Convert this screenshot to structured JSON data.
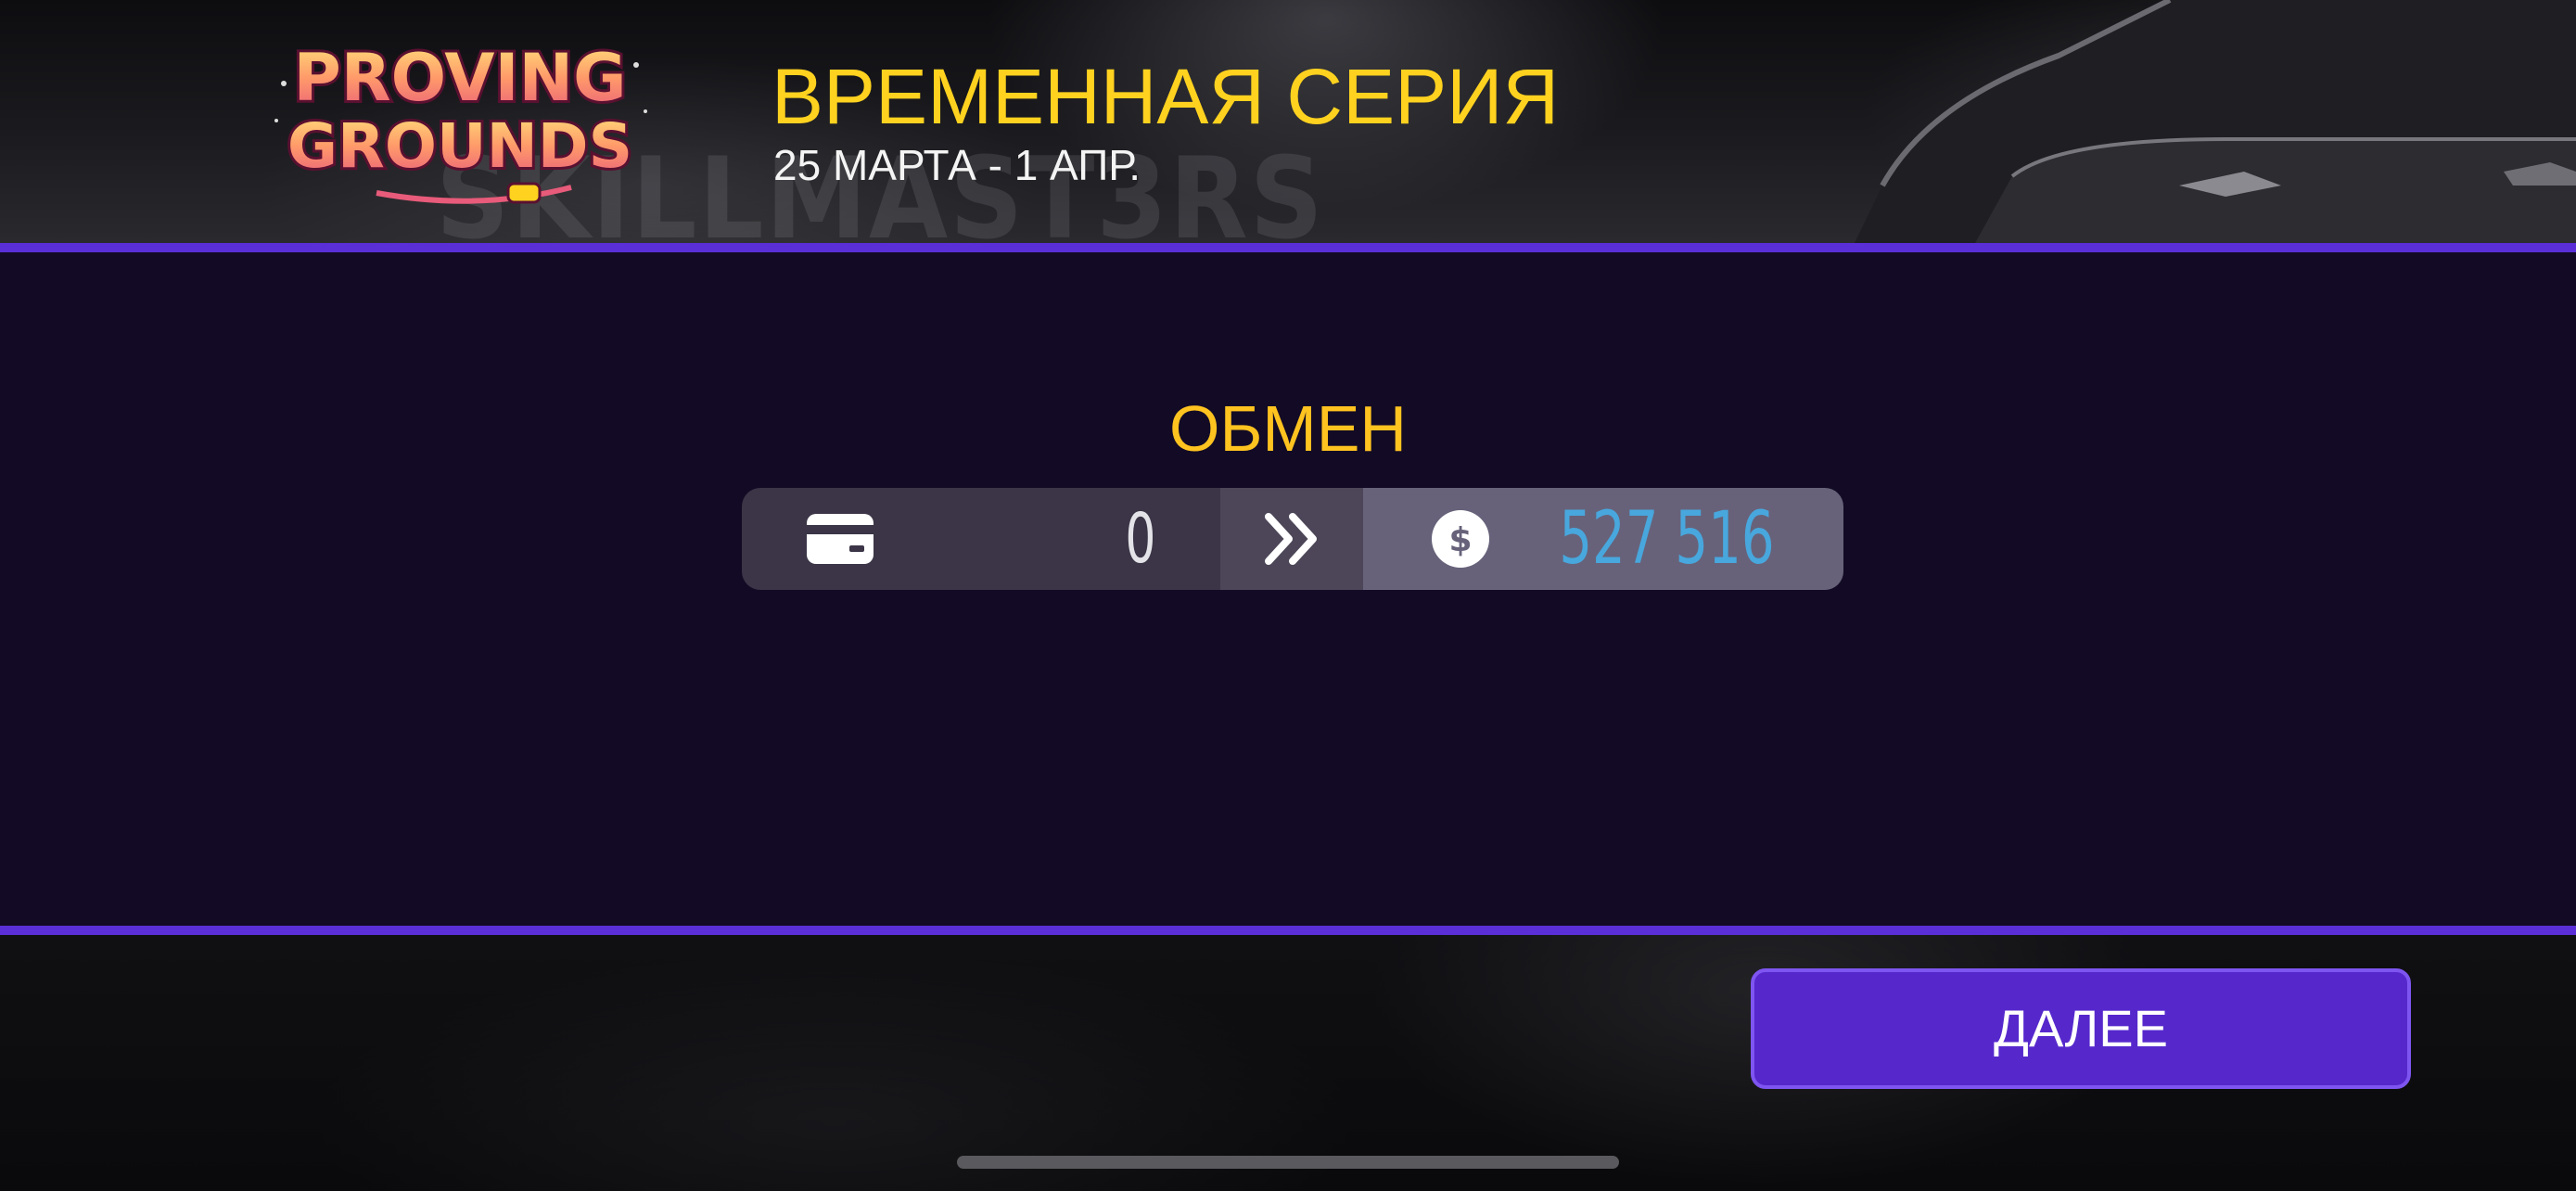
{
  "banner": {
    "logo_text_line1": "PROVING",
    "logo_text_line2": "GROUNDS",
    "background_text": "SKILLMAST3RS",
    "title": "ВРЕМЕННАЯ СЕРИЯ",
    "subtitle": "25 МАРТА - 1 АПР."
  },
  "exchange": {
    "title": "ОБМЕН",
    "from_icon": "card-icon",
    "from_value": "0",
    "arrow_icon": "double-chevron-right-icon",
    "to_icon": "dollar-coin-icon",
    "to_value": "527 516"
  },
  "actions": {
    "next_label": "ДАЛЕЕ"
  },
  "colors": {
    "accent_purple": "#5a2fd8",
    "title_yellow": "#ffd21f",
    "value_blue": "#48a7dd",
    "panel_bg": "#130b25",
    "button_bg": "#5628cc"
  }
}
